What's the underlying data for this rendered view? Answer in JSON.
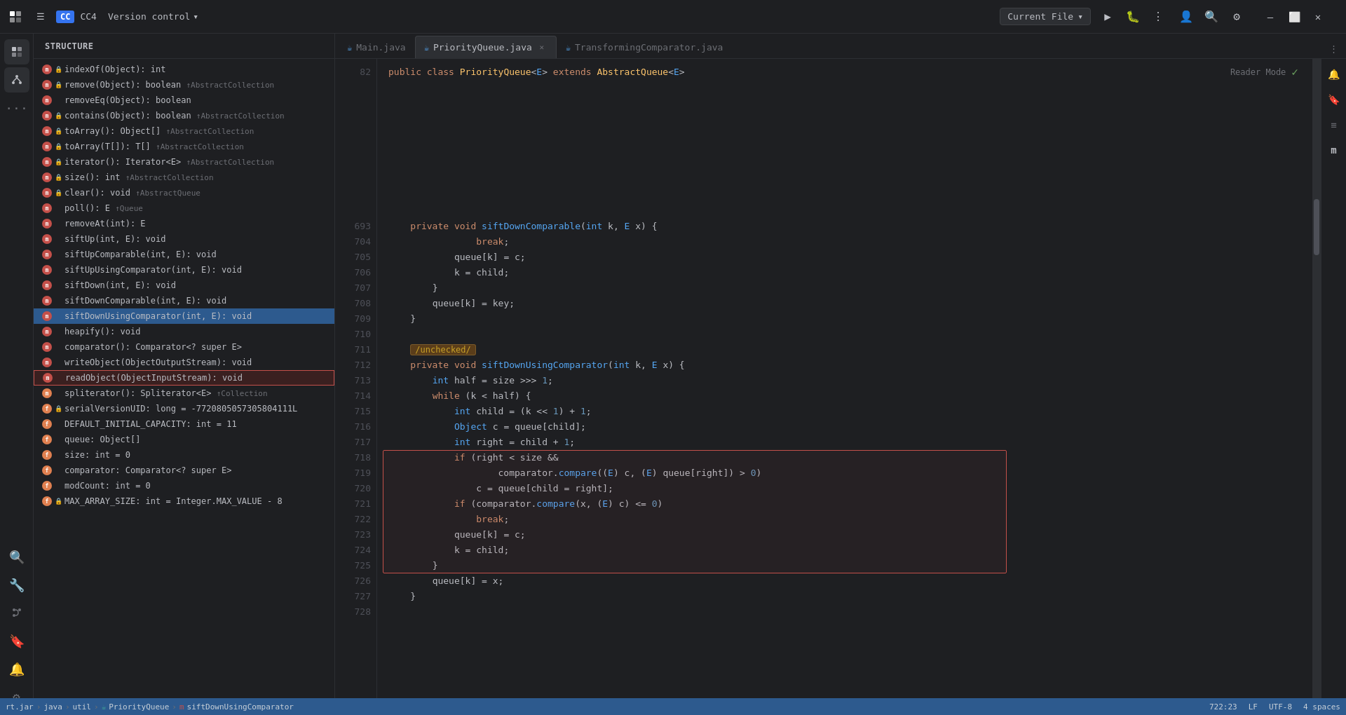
{
  "titlebar": {
    "app_logo": "⬜",
    "hamburger": "☰",
    "project_badge": "CC",
    "project_name": "CC4",
    "version_control": "Version control",
    "chevron": "▾",
    "current_file": "Current File",
    "current_file_chevron": "▾"
  },
  "tabs": [
    {
      "id": "main",
      "label": "Main.java",
      "active": false,
      "closable": false
    },
    {
      "id": "priorityqueue",
      "label": "PriorityQueue.java",
      "active": true,
      "closable": true
    },
    {
      "id": "transforming",
      "label": "TransformingComparator.java",
      "active": false,
      "closable": false
    }
  ],
  "sidebar": {
    "title": "Structure",
    "items": [
      {
        "icon": "m",
        "icon_class": "icon-red",
        "lock": true,
        "text": "indexOf(Object): int",
        "inherited": ""
      },
      {
        "icon": "m",
        "icon_class": "icon-red",
        "lock": true,
        "text": "remove(Object): boolean",
        "inherited": "↑AbstractCollection"
      },
      {
        "icon": "m",
        "icon_class": "icon-red",
        "lock": false,
        "text": "removeEq(Object): boolean",
        "inherited": ""
      },
      {
        "icon": "m",
        "icon_class": "icon-red",
        "lock": true,
        "text": "contains(Object): boolean",
        "inherited": "↑AbstractCollection"
      },
      {
        "icon": "m",
        "icon_class": "icon-red",
        "lock": true,
        "text": "toArray(): Object[]",
        "inherited": "↑AbstractCollection"
      },
      {
        "icon": "m",
        "icon_class": "icon-red",
        "lock": true,
        "text": "toArray(T[]): T[]",
        "inherited": "↑AbstractCollection"
      },
      {
        "icon": "m",
        "icon_class": "icon-red",
        "lock": true,
        "text": "iterator(): Iterator<E>",
        "inherited": "↑AbstractCollection"
      },
      {
        "icon": "m",
        "icon_class": "icon-red",
        "lock": true,
        "text": "size(): int",
        "inherited": "↑AbstractCollection"
      },
      {
        "icon": "m",
        "icon_class": "icon-red",
        "lock": true,
        "text": "clear(): void",
        "inherited": "↑AbstractQueue"
      },
      {
        "icon": "m",
        "icon_class": "icon-red",
        "lock": false,
        "text": "poll(): E",
        "inherited": "↑Queue"
      },
      {
        "icon": "m",
        "icon_class": "icon-red",
        "lock": false,
        "text": "removeAt(int): E",
        "inherited": ""
      },
      {
        "icon": "m",
        "icon_class": "icon-red",
        "lock": false,
        "text": "siftUp(int, E): void",
        "inherited": ""
      },
      {
        "icon": "m",
        "icon_class": "icon-red",
        "lock": false,
        "text": "siftUpComparable(int, E): void",
        "inherited": ""
      },
      {
        "icon": "m",
        "icon_class": "icon-red",
        "lock": false,
        "text": "siftUpUsingComparator(int, E): void",
        "inherited": ""
      },
      {
        "icon": "m",
        "icon_class": "icon-red",
        "lock": false,
        "text": "siftDown(int, E): void",
        "inherited": ""
      },
      {
        "icon": "m",
        "icon_class": "icon-red",
        "lock": false,
        "text": "siftDownComparable(int, E): void",
        "inherited": ""
      },
      {
        "icon": "m",
        "icon_class": "icon-red",
        "lock": false,
        "text": "siftDownUsingComparator(int, E): void",
        "inherited": "",
        "selected": true
      },
      {
        "icon": "m",
        "icon_class": "icon-red",
        "lock": false,
        "text": "heapify(): void",
        "inherited": ""
      },
      {
        "icon": "m",
        "icon_class": "icon-red",
        "lock": false,
        "text": "comparator(): Comparator<? super E>",
        "inherited": ""
      },
      {
        "icon": "m",
        "icon_class": "icon-red",
        "lock": false,
        "text": "writeObject(ObjectOutputStream): void",
        "inherited": ""
      },
      {
        "icon": "m",
        "icon_class": "icon-red",
        "lock": false,
        "text": "readObject(ObjectInputStream): void",
        "inherited": "",
        "selected_red": true
      },
      {
        "icon": "m",
        "icon_class": "icon-orange",
        "lock": false,
        "text": "spliterator(): Spliterator<E>",
        "inherited": "↑Collection"
      },
      {
        "icon": "f",
        "icon_class": "icon-orange",
        "lock": true,
        "text": "serialVersionUID: long = -7720805057305804111L",
        "inherited": ""
      },
      {
        "icon": "f",
        "icon_class": "icon-orange",
        "lock": false,
        "text": "DEFAULT_INITIAL_CAPACITY: int = 11",
        "inherited": ""
      },
      {
        "icon": "f",
        "icon_class": "icon-orange",
        "lock": false,
        "text": "queue: Object[]",
        "inherited": ""
      },
      {
        "icon": "f",
        "icon_class": "icon-orange",
        "lock": false,
        "text": "size: int = 0",
        "inherited": ""
      },
      {
        "icon": "f",
        "icon_class": "icon-orange",
        "lock": false,
        "text": "comparator: Comparator<? super E>",
        "inherited": ""
      },
      {
        "icon": "f",
        "icon_class": "icon-orange",
        "lock": false,
        "text": "modCount: int = 0",
        "inherited": ""
      },
      {
        "icon": "f",
        "icon_class": "icon-orange",
        "lock": true,
        "text": "MAX_ARRAY_SIZE: int = Integer.MAX_VALUE - 8",
        "inherited": ""
      }
    ]
  },
  "code": {
    "reader_mode_label": "Reader Mode",
    "lines": [
      {
        "num": "82",
        "content": "public_class_PriorityQueue_code"
      },
      {
        "num": "693",
        "content": "private_void_siftDownComparable_code"
      },
      {
        "num": "704",
        "content": "break_code"
      },
      {
        "num": "705",
        "content": "queue_k_c_code"
      },
      {
        "num": "706",
        "content": "k_child_code"
      },
      {
        "num": "707",
        "content": "close_brace_code"
      },
      {
        "num": "708",
        "content": "queue_k_key_code"
      },
      {
        "num": "709",
        "content": "close_brace_code2"
      },
      {
        "num": "710",
        "content": "empty_code"
      },
      {
        "num": "711",
        "content": "unchecked_code"
      },
      {
        "num": "712",
        "content": "private_void_siftDownUsing_code"
      },
      {
        "num": "713",
        "content": "int_half_code"
      },
      {
        "num": "714",
        "content": "while_k_half_code"
      },
      {
        "num": "715",
        "content": "int_child_code"
      },
      {
        "num": "716",
        "content": "object_c_code"
      },
      {
        "num": "717",
        "content": "int_right_code"
      },
      {
        "num": "718",
        "content": "if_right_size_code"
      },
      {
        "num": "719",
        "content": "comparator_compare_code"
      },
      {
        "num": "720",
        "content": "c_queue_code"
      },
      {
        "num": "721",
        "content": "if_comparator_x_code"
      },
      {
        "num": "722",
        "content": "break2_code"
      },
      {
        "num": "723",
        "content": "queue_k_c2_code"
      },
      {
        "num": "724",
        "content": "k_child2_code"
      },
      {
        "num": "725",
        "content": "close_brace3_code"
      },
      {
        "num": "726",
        "content": "queue_k_x_code"
      },
      {
        "num": "727",
        "content": "close_brace4_code"
      },
      {
        "num": "728",
        "content": "empty2_code"
      }
    ]
  },
  "status": {
    "breadcrumb_items": [
      "rt.jar",
      "java",
      "util",
      "PriorityQueue",
      "siftDownUsingComparator"
    ],
    "position": "722:23",
    "line_ending": "LF",
    "encoding": "UTF-8",
    "indent": "4 spaces"
  }
}
